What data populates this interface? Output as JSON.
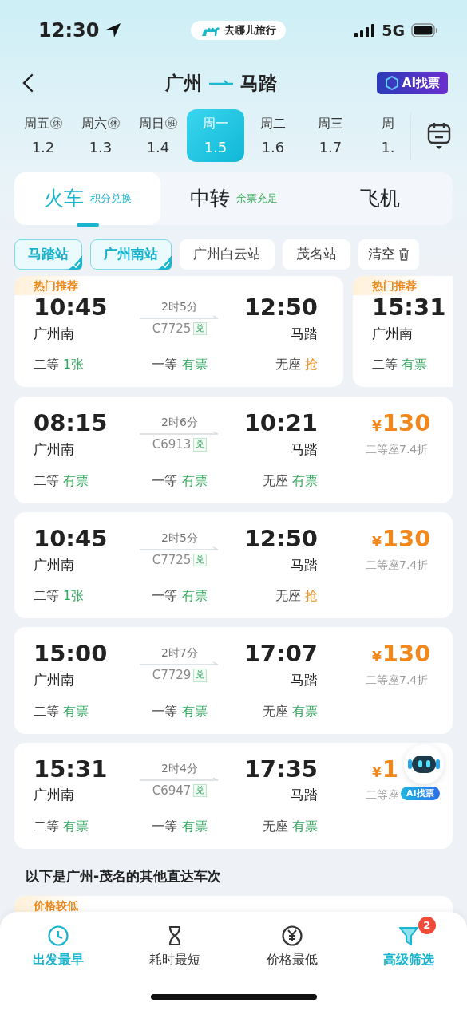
{
  "status_bar": {
    "time": "12:30",
    "app": "去哪儿旅行",
    "network": "5G"
  },
  "header": {
    "from": "广州",
    "to": "马踏",
    "ai_button": "AI找票"
  },
  "dates": [
    {
      "weekday": "周五",
      "tag": "休",
      "date": "1.2",
      "selected": false
    },
    {
      "weekday": "周六",
      "tag": "休",
      "date": "1.3",
      "selected": false
    },
    {
      "weekday": "周日",
      "tag": "班",
      "date": "1.4",
      "selected": false
    },
    {
      "weekday": "周一",
      "date": "1.5",
      "selected": true
    },
    {
      "weekday": "周二",
      "date": "1.6",
      "selected": false
    },
    {
      "weekday": "周三",
      "date": "1.7",
      "selected": false
    },
    {
      "weekday": "周",
      "date": "1.",
      "selected": false
    }
  ],
  "modes": [
    {
      "label": "火车",
      "note": "积分兑换",
      "selected": true
    },
    {
      "label": "中转",
      "note": "余票充足",
      "selected": false
    },
    {
      "label": "飞机",
      "selected": false
    }
  ],
  "stations": [
    {
      "label": "马踏站",
      "selected": true
    },
    {
      "label": "广州南站",
      "selected": true
    },
    {
      "label": "广州白云站",
      "selected": false
    },
    {
      "label": "茂名站",
      "selected": false
    }
  ],
  "clear_button": "清空",
  "recommended": [
    {
      "tag": "热门推荐",
      "depart": "10:45",
      "from": "广州南",
      "duration": "2时5分",
      "train": "C7725",
      "badge": "兑",
      "arrive": "12:50",
      "to": "马踏",
      "seats": [
        {
          "class": "二等",
          "status": "1张",
          "kind": "available"
        },
        {
          "class": "一等",
          "status": "有票",
          "kind": "available"
        },
        {
          "class": "无座",
          "status": "抢",
          "kind": "rush"
        }
      ]
    },
    {
      "tag": "热门推荐",
      "depart": "15:31",
      "from": "广州南",
      "seats": [
        {
          "class": "二等",
          "status": "有票",
          "kind": "available"
        }
      ]
    }
  ],
  "trains": [
    {
      "depart": "08:15",
      "from": "广州南",
      "duration": "2时6分",
      "train": "C6913",
      "badge": "兑",
      "arrive": "10:21",
      "to": "马踏",
      "currency": "¥",
      "price": "130",
      "discount": "二等座7.4折",
      "seats": [
        {
          "class": "二等",
          "status": "有票",
          "kind": "available"
        },
        {
          "class": "一等",
          "status": "有票",
          "kind": "available"
        },
        {
          "class": "无座",
          "status": "有票",
          "kind": "available"
        }
      ]
    },
    {
      "depart": "10:45",
      "from": "广州南",
      "duration": "2时5分",
      "train": "C7725",
      "badge": "兑",
      "arrive": "12:50",
      "to": "马踏",
      "currency": "¥",
      "price": "130",
      "discount": "二等座7.4折",
      "seats": [
        {
          "class": "二等",
          "status": "1张",
          "kind": "available"
        },
        {
          "class": "一等",
          "status": "有票",
          "kind": "available"
        },
        {
          "class": "无座",
          "status": "抢",
          "kind": "rush"
        }
      ]
    },
    {
      "depart": "15:00",
      "from": "广州南",
      "duration": "2时7分",
      "train": "C7729",
      "badge": "兑",
      "arrive": "17:07",
      "to": "马踏",
      "currency": "¥",
      "price": "130",
      "discount": "二等座7.4折",
      "seats": [
        {
          "class": "二等",
          "status": "有票",
          "kind": "available"
        },
        {
          "class": "一等",
          "status": "有票",
          "kind": "available"
        },
        {
          "class": "无座",
          "status": "有票",
          "kind": "available"
        }
      ]
    },
    {
      "depart": "15:31",
      "from": "广州南",
      "duration": "2时4分",
      "train": "C6947",
      "badge": "兑",
      "arrive": "17:35",
      "to": "马踏",
      "currency": "¥",
      "price": "1",
      "discount": "二等座",
      "seats": [
        {
          "class": "二等",
          "status": "有票",
          "kind": "available"
        },
        {
          "class": "一等",
          "status": "有票",
          "kind": "available"
        },
        {
          "class": "无座",
          "status": "有票",
          "kind": "available"
        }
      ]
    }
  ],
  "ai_float": {
    "label": "AI找票"
  },
  "section_title": "以下是广州-茂名的其他直达车次",
  "next_tag": "价格较低",
  "sort_options": [
    {
      "label": "出发最早",
      "kind": "clock",
      "selected": true
    },
    {
      "label": "耗时最短",
      "kind": "hourglass",
      "selected": false
    },
    {
      "label": "价格最低",
      "kind": "yen",
      "selected": false
    }
  ],
  "filter": {
    "label": "高级筛选",
    "badge": "2"
  }
}
